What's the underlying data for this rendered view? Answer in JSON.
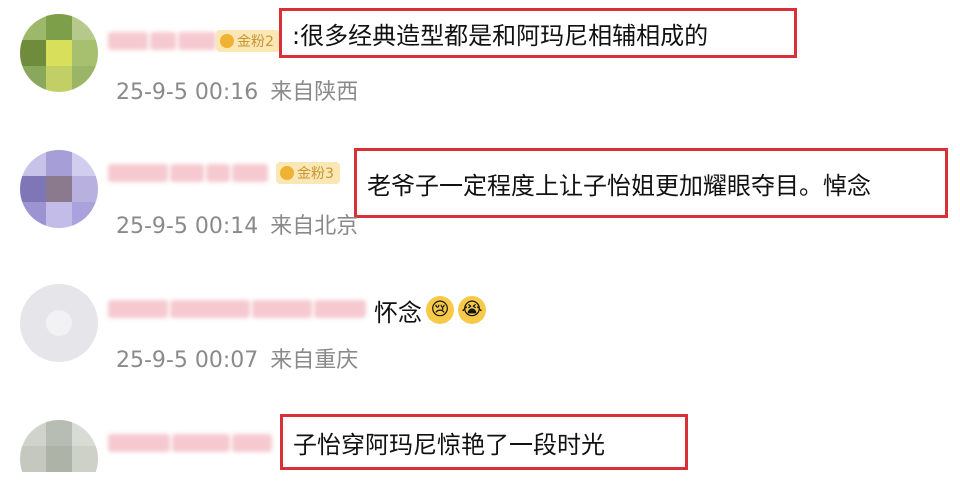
{
  "comments": [
    {
      "badge": "金粉2",
      "text": ":很多经典造型都是和阿玛尼相辅相成的",
      "time": "25-9-5 00:16",
      "location": "来自陕西",
      "highlighted": true
    },
    {
      "badge": "金粉3",
      "text": "老爷子一定程度上让子怡姐更加耀眼夺目。悼念",
      "time": "25-9-5 00:14",
      "location": "来自北京",
      "highlighted": true
    },
    {
      "badge": "",
      "text": "怀念",
      "time": "25-9-5 00:07",
      "location": "来自重庆",
      "highlighted": false,
      "emojis": [
        "cry-smile-emoji",
        "crying-emoji"
      ]
    },
    {
      "badge": "",
      "text": "子怡穿阿玛尼惊艳了一段时光",
      "time": "",
      "location": "",
      "highlighted": true
    }
  ],
  "colors": {
    "highlight_border": "#d93037",
    "blur_name": "#f5c9cf",
    "badge_bg": "#fbe7b5",
    "badge_text": "#c8962f",
    "meta_text": "#8a8a8a"
  }
}
